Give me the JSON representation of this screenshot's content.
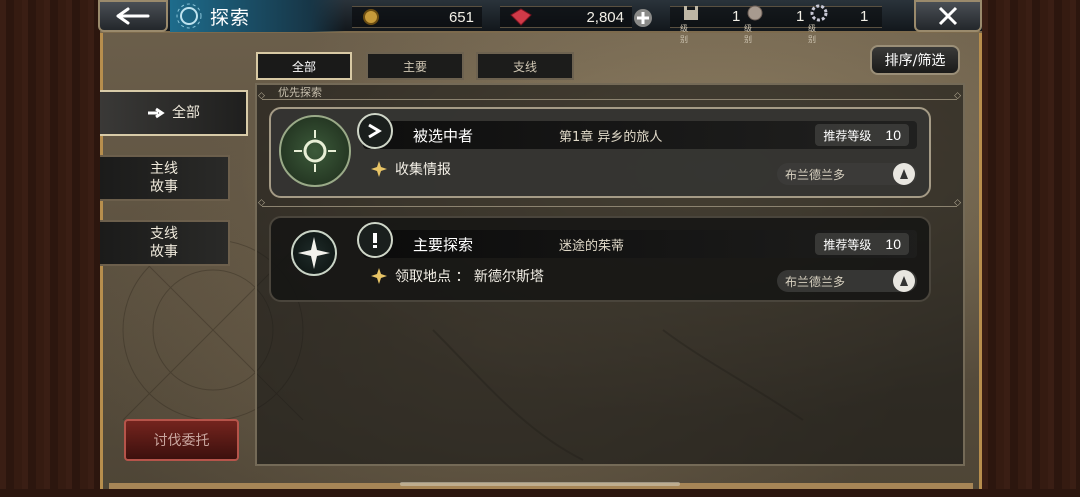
{
  "header": {
    "title": "探索",
    "gold": "651",
    "gems": "2,804",
    "levels": [
      {
        "caption": "级别",
        "value": "1",
        "icon": "castle-icon"
      },
      {
        "caption": "级别",
        "value": "1",
        "icon": "crest-icon"
      },
      {
        "caption": "级别",
        "value": "1",
        "icon": "gear-crest-icon"
      }
    ]
  },
  "tabs": [
    {
      "label": "全部",
      "active": true
    },
    {
      "label": "主要",
      "active": false
    },
    {
      "label": "支线",
      "active": false
    }
  ],
  "sort_button": "排序/筛选",
  "sidebar": {
    "items": [
      {
        "label": "全部",
        "active": true
      },
      {
        "label": "主线\n故事",
        "active": false
      },
      {
        "label": "支线\n故事",
        "active": false
      }
    ],
    "bottom_button": "讨伐委托"
  },
  "section": {
    "title": "优先探索"
  },
  "quests": [
    {
      "name": "被选中者",
      "chapter": "第1章  异乡的旅人",
      "rec_label": "推荐等级",
      "rec_level": "10",
      "objective": "收集情报",
      "region": "布兰德兰多"
    },
    {
      "name": "主要探索",
      "chapter": "迷途的茱蒂",
      "rec_label": "推荐等级",
      "rec_level": "10",
      "objective": "领取地点  ：  新德尔斯塔",
      "region": "布兰德兰多"
    }
  ],
  "colors": {
    "accent": "#1e6c8c",
    "frame": "#b78e4d",
    "hunt": "#74241e"
  }
}
